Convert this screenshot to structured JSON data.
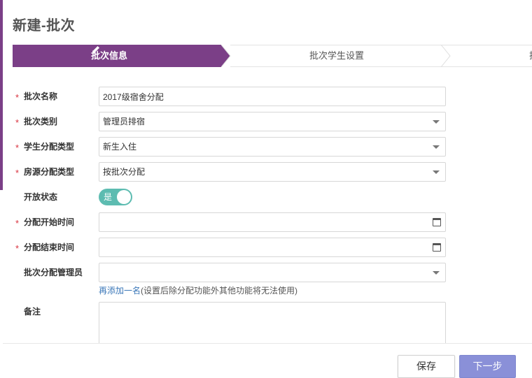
{
  "page": {
    "title": "新建-批次"
  },
  "steps": [
    {
      "label": "批次信息",
      "active": true
    },
    {
      "label": "批次学生设置",
      "active": false
    },
    {
      "label": "批",
      "active": false
    }
  ],
  "form": {
    "batch_name": {
      "label": "批次名称",
      "required": true,
      "value": "2017级宿舍分配"
    },
    "batch_type": {
      "label": "批次类别",
      "required": true,
      "value": "管理员排宿"
    },
    "student_alloc_type": {
      "label": "学生分配类型",
      "required": true,
      "value": "新生入住"
    },
    "room_alloc_type": {
      "label": "房源分配类型",
      "required": true,
      "value": "按批次分配"
    },
    "open_status": {
      "label": "开放状态",
      "required": false,
      "value": "是",
      "on": true
    },
    "alloc_start_time": {
      "label": "分配开始时间",
      "required": true,
      "value": ""
    },
    "alloc_end_time": {
      "label": "分配结束时间",
      "required": true,
      "value": ""
    },
    "batch_admin": {
      "label": "批次分配管理员",
      "required": false,
      "value": ""
    },
    "admin_hint": {
      "link": "再添加一名",
      "text": "(设置后除分配功能外其他功能将无法使用)"
    },
    "remarks": {
      "label": "备注",
      "required": false,
      "value": ""
    }
  },
  "footer": {
    "save_label": "保存",
    "next_label": "下一步"
  },
  "colors": {
    "accent": "#7b3f87",
    "toggle": "#5dbcb1",
    "primary_button": "#8a90d8",
    "required": "#d9333f",
    "link": "#3a77b8"
  },
  "icons": {
    "step_active": "pencil-icon",
    "select": "chevron-down-icon",
    "date": "calendar-icon"
  }
}
